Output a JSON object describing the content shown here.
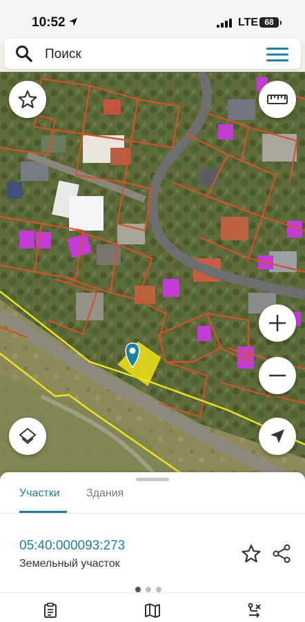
{
  "status_bar": {
    "time": "10:52",
    "network": "LTE",
    "battery": "68"
  },
  "search": {
    "placeholder": "Поиск"
  },
  "tabs": [
    {
      "label": "Участки",
      "active": true
    },
    {
      "label": "Здания",
      "active": false
    }
  ],
  "parcel": {
    "cadastral_number": "05:40:000093:273",
    "type": "Земельный участок"
  },
  "pager": {
    "count": 3,
    "active_index": 0
  },
  "colors": {
    "accent": "#1e7f9e",
    "parcel_border": "#d2522a",
    "selected_parcel": "#f0e31a",
    "building_highlight": "#c33bd6"
  },
  "icons": {
    "search": "search-icon",
    "menu": "hamburger-menu-icon",
    "favorite": "star-icon",
    "ruler": "ruler-icon",
    "zoom_in": "plus-icon",
    "zoom_out": "minus-icon",
    "layers": "layers-icon",
    "locate": "navigation-arrow-icon",
    "share": "share-icon",
    "nav_list": "clipboard-icon",
    "nav_map": "map-icon",
    "nav_filter": "route-filter-icon"
  }
}
